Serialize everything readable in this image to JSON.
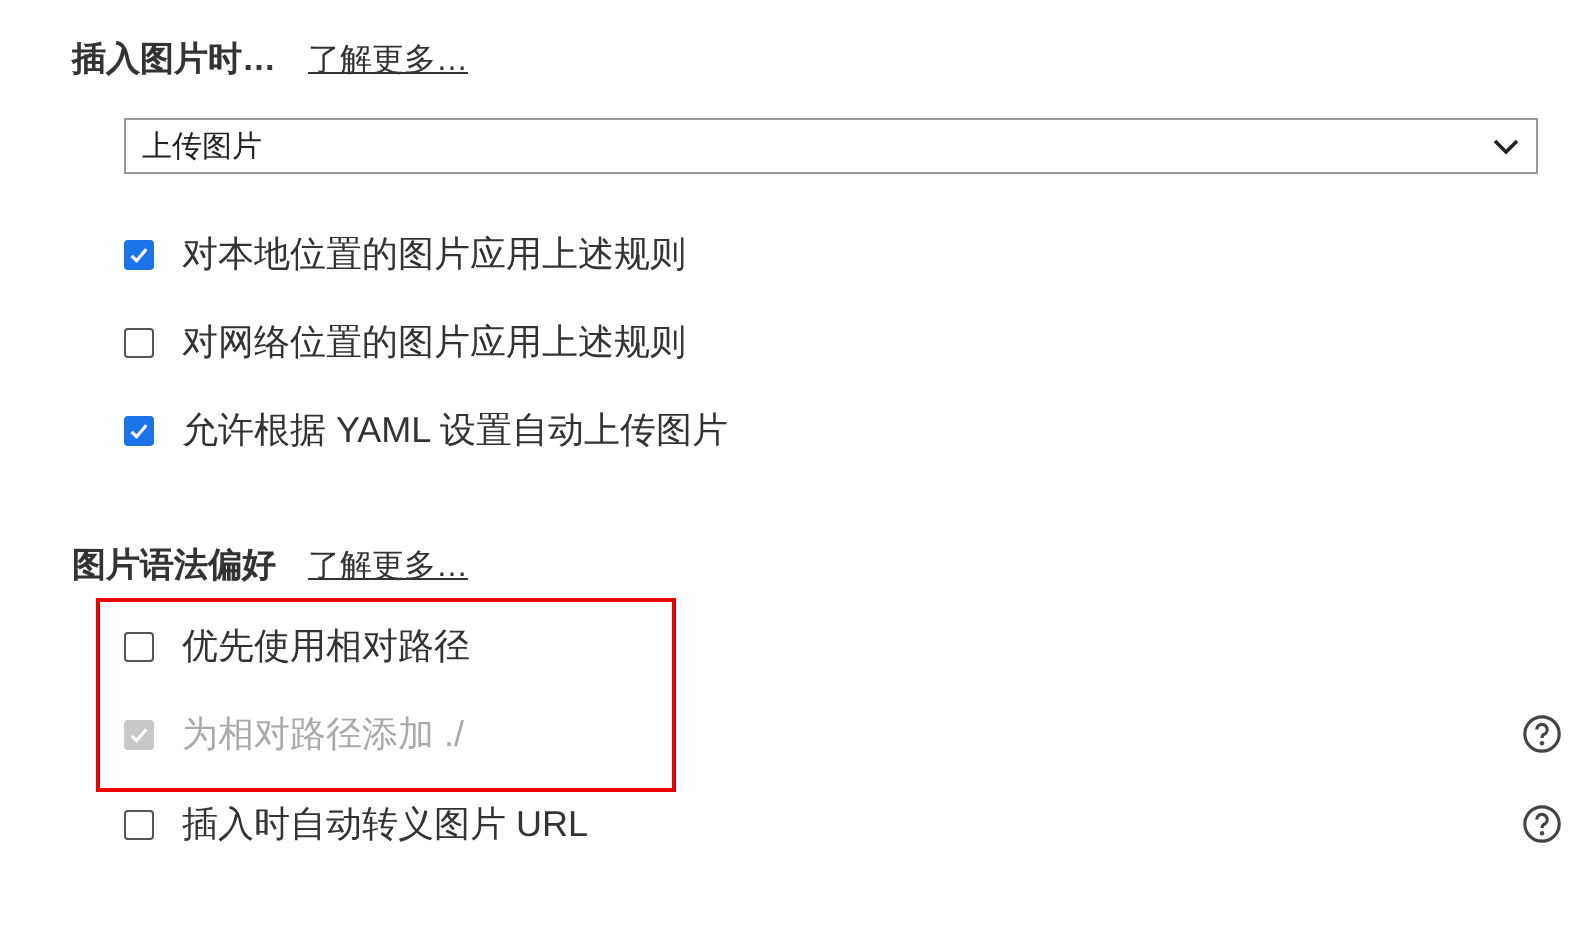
{
  "sections": [
    {
      "title": "插入图片时…",
      "link": "了解更多…",
      "dropdown": {
        "value": "上传图片"
      },
      "options": [
        {
          "label": "对本地位置的图片应用上述规则",
          "checked": true,
          "disabled": false,
          "help": false,
          "highlighted": false
        },
        {
          "label": "对网络位置的图片应用上述规则",
          "checked": false,
          "disabled": false,
          "help": false,
          "highlighted": false
        },
        {
          "label": "允许根据 YAML 设置自动上传图片",
          "checked": true,
          "disabled": false,
          "help": false,
          "highlighted": false
        }
      ]
    },
    {
      "title": "图片语法偏好",
      "link": "了解更多…",
      "options": [
        {
          "label": "优先使用相对路径",
          "checked": false,
          "disabled": false,
          "help": false,
          "highlighted": true
        },
        {
          "label": "为相对路径添加 ./",
          "checked": true,
          "disabled": true,
          "help": true,
          "highlighted": true
        },
        {
          "label": "插入时自动转义图片 URL",
          "checked": false,
          "disabled": false,
          "help": true,
          "highlighted": false
        }
      ]
    }
  ]
}
